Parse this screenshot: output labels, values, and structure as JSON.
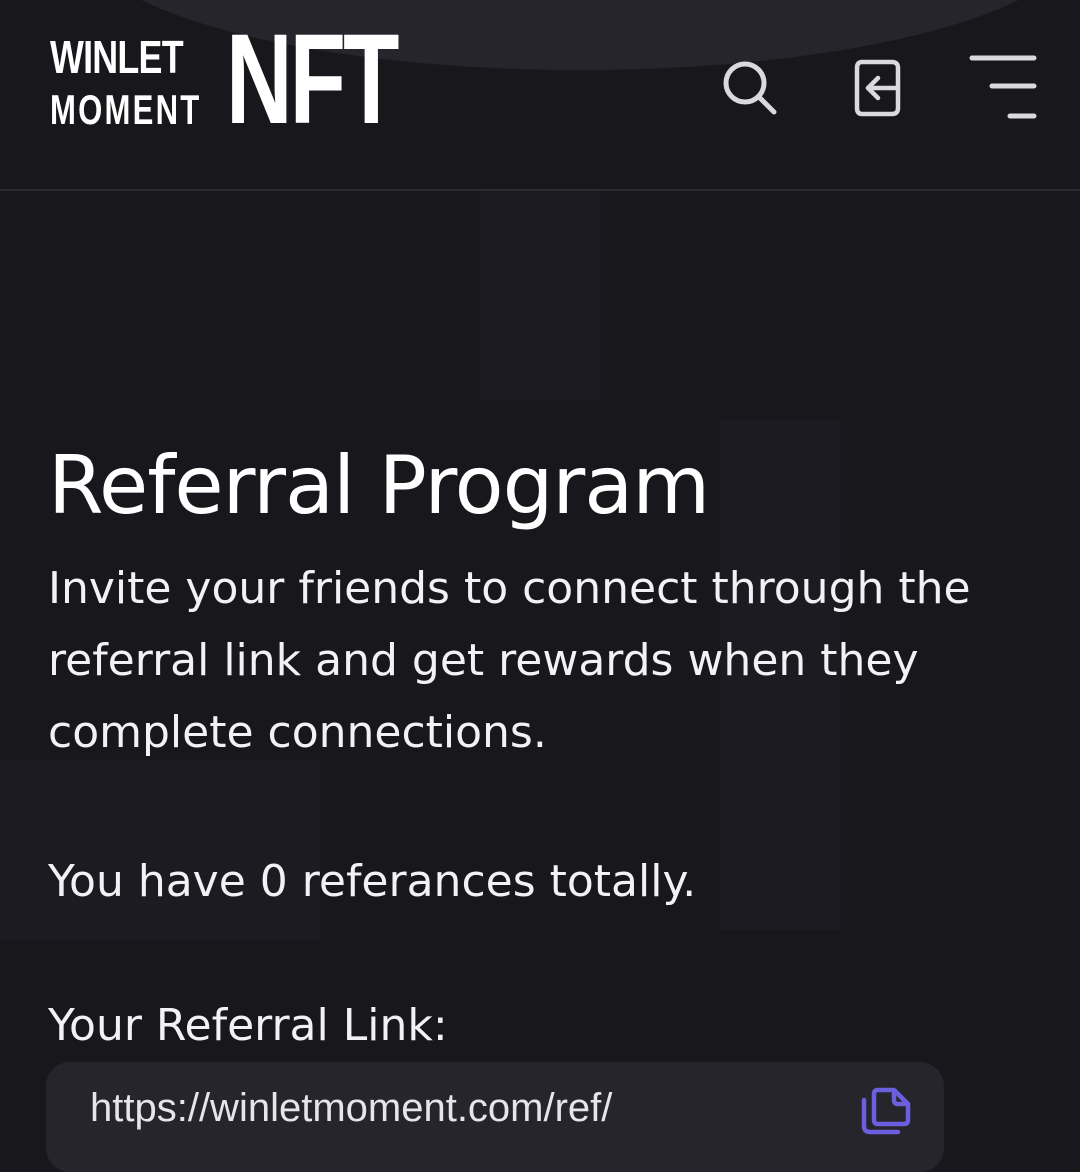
{
  "header": {
    "logo_line1": "WINLET",
    "logo_line2": "MOMENT",
    "logo_nft": "NFT",
    "icons": [
      "search-icon",
      "login-icon",
      "menu-icon"
    ]
  },
  "main": {
    "title": "Referral Program",
    "description": "Invite your friends to connect through the referral link and get rewards when they complete connections.",
    "referral_count_text": "You have 0 referances totally.",
    "link_label": "Your Referral Link:",
    "link_value": "https://winletmoment.com/ref/",
    "copy_icon": "copy-icon"
  },
  "colors": {
    "background": "#18171c",
    "header_notch": "#26252b",
    "input_bg": "#26252b",
    "text": "#f2f2f4",
    "accent": "#6b5fe0"
  }
}
